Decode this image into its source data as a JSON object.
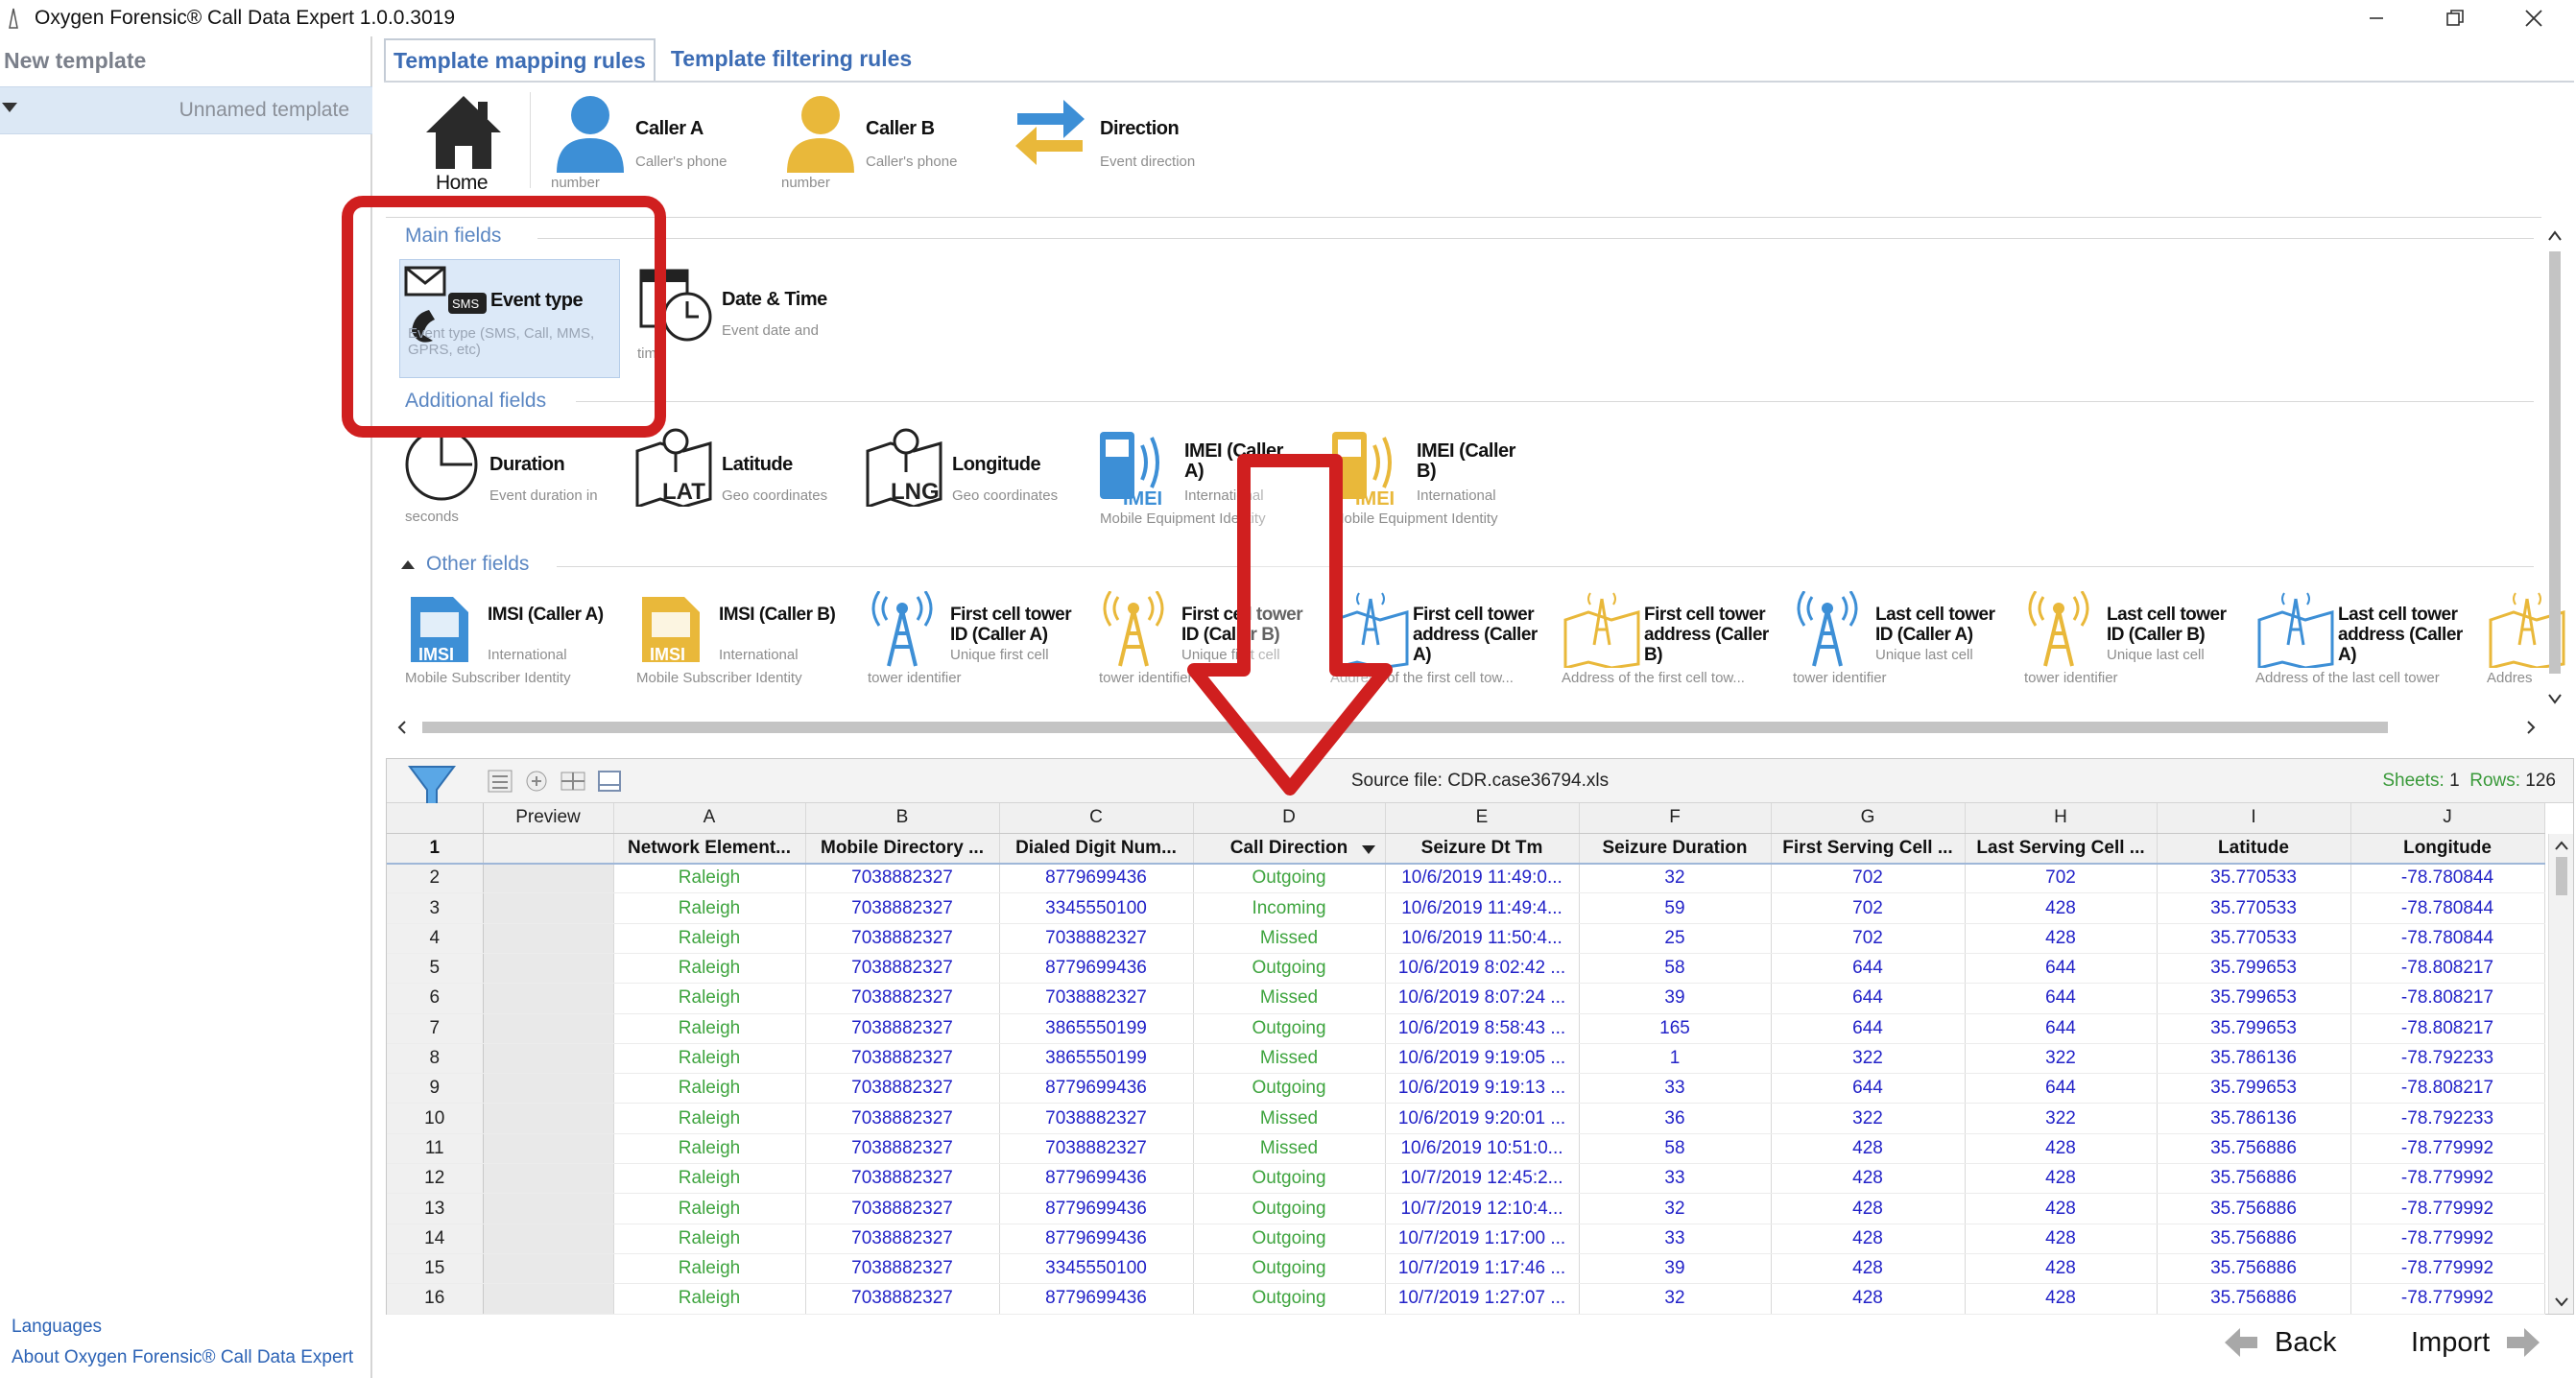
{
  "window": {
    "title": "Oxygen Forensic® Call Data Expert 1.0.0.3019"
  },
  "left_panel": {
    "title": "New template",
    "item": "Unnamed template",
    "links": [
      "Languages",
      "About Oxygen Forensic® Call Data Expert"
    ]
  },
  "tabs": [
    {
      "label": "Template mapping rules",
      "active": true
    },
    {
      "label": "Template filtering rules",
      "active": false
    }
  ],
  "top_row": {
    "home": "Home",
    "caller_a": {
      "title": "Caller A",
      "sub": "Caller's phone",
      "sub2": "number"
    },
    "caller_b": {
      "title": "Caller B",
      "sub": "Caller's phone",
      "sub2": "number"
    },
    "direction": {
      "title": "Direction",
      "sub": "Event direction"
    }
  },
  "sections": {
    "main": "Main fields",
    "additional": "Additional fields",
    "other": "Other fields"
  },
  "main_fields": {
    "event_type": {
      "title": "Event type",
      "sub": "Event type (SMS, Call, MMS, GPRS, etc)"
    },
    "date_time": {
      "title": "Date & Time",
      "sub": "Event date and",
      "sub2": "time"
    }
  },
  "additional_fields": {
    "duration": {
      "title": "Duration",
      "sub": "Event duration in",
      "sub2": "seconds"
    },
    "latitude": {
      "title": "Latitude",
      "sub": "Geo coordinates"
    },
    "longitude": {
      "title": "Longitude",
      "sub": "Geo coordinates"
    },
    "imei_a": {
      "title": "IMEI (Caller A)",
      "sub": "International",
      "sub2": "Mobile Equipment Identity"
    },
    "imei_b": {
      "title": "IMEI (Caller B)",
      "sub": "International",
      "sub2": "Mobile Equipment Identity"
    }
  },
  "other_fields": [
    {
      "title": "IMSI (Caller A)",
      "sub": "International",
      "sub2": "Mobile Subscriber Identity",
      "icon": "sim-blue"
    },
    {
      "title": "IMSI (Caller B)",
      "sub": "International",
      "sub2": "Mobile Subscriber Identity",
      "icon": "sim-gold"
    },
    {
      "title": "First cell tower ID (Caller A)",
      "sub": "Unique first cell",
      "sub2": "tower identifier",
      "icon": "tower-blue"
    },
    {
      "title": "First cell tower ID (Caller B)",
      "sub": "Unique first cell",
      "sub2": "tower identifier",
      "icon": "tower-gold"
    },
    {
      "title": "First cell tower address (Caller A)",
      "sub": "",
      "sub2": "Address of the first cell tow...",
      "icon": "map-blue"
    },
    {
      "title": "First cell tower address (Caller B)",
      "sub": "",
      "sub2": "Address of the first cell tow...",
      "icon": "map-gold"
    },
    {
      "title": "Last cell tower ID (Caller A)",
      "sub": "Unique last cell",
      "sub2": "tower identifier",
      "icon": "tower-blue"
    },
    {
      "title": "Last cell tower ID (Caller B)",
      "sub": "Unique last cell",
      "sub2": "tower identifier",
      "icon": "tower-gold"
    },
    {
      "title": "Last cell tower address (Caller A)",
      "sub": "",
      "sub2": "Address of the last cell tower",
      "icon": "map-blue"
    },
    {
      "title": "",
      "sub": "",
      "sub2": "Addres",
      "icon": "map-gold"
    }
  ],
  "grid": {
    "source": "Source file: CDR.case36794.xls",
    "sheets_label": "Sheets:",
    "sheets": "1",
    "rows_label": "Rows:",
    "rows": "126",
    "preview_label": "Preview",
    "letters": [
      "A",
      "B",
      "C",
      "D",
      "E",
      "F",
      "G",
      "H",
      "I",
      "J"
    ],
    "headers": [
      "Network Element...",
      "Mobile Directory ...",
      "Dialed Digit Num...",
      "Call Direction",
      "Seizure Dt Tm",
      "Seizure Duration",
      "First Serving Cell ...",
      "Last Serving Cell ...",
      "Latitude",
      "Longitude"
    ],
    "rows_data": [
      {
        "n": "2",
        "cells": [
          "Raleigh",
          "7038882327",
          "8779699436",
          "Outgoing",
          "10/6/2019 11:49:0...",
          "32",
          "702",
          "702",
          "35.770533",
          "-78.780844"
        ]
      },
      {
        "n": "3",
        "cells": [
          "Raleigh",
          "7038882327",
          "3345550100",
          "Incoming",
          "10/6/2019 11:49:4...",
          "59",
          "702",
          "428",
          "35.770533",
          "-78.780844"
        ]
      },
      {
        "n": "4",
        "cells": [
          "Raleigh",
          "7038882327",
          "7038882327",
          "Missed",
          "10/6/2019 11:50:4...",
          "25",
          "702",
          "428",
          "35.770533",
          "-78.780844"
        ]
      },
      {
        "n": "5",
        "cells": [
          "Raleigh",
          "7038882327",
          "8779699436",
          "Outgoing",
          "10/6/2019 8:02:42 ...",
          "58",
          "644",
          "644",
          "35.799653",
          "-78.808217"
        ]
      },
      {
        "n": "6",
        "cells": [
          "Raleigh",
          "7038882327",
          "7038882327",
          "Missed",
          "10/6/2019 8:07:24 ...",
          "39",
          "644",
          "644",
          "35.799653",
          "-78.808217"
        ]
      },
      {
        "n": "7",
        "cells": [
          "Raleigh",
          "7038882327",
          "3865550199",
          "Outgoing",
          "10/6/2019 8:58:43 ...",
          "165",
          "644",
          "644",
          "35.799653",
          "-78.808217"
        ]
      },
      {
        "n": "8",
        "cells": [
          "Raleigh",
          "7038882327",
          "3865550199",
          "Missed",
          "10/6/2019 9:19:05 ...",
          "1",
          "322",
          "322",
          "35.786136",
          "-78.792233"
        ]
      },
      {
        "n": "9",
        "cells": [
          "Raleigh",
          "7038882327",
          "8779699436",
          "Outgoing",
          "10/6/2019 9:19:13 ...",
          "33",
          "644",
          "644",
          "35.799653",
          "-78.808217"
        ]
      },
      {
        "n": "10",
        "cells": [
          "Raleigh",
          "7038882327",
          "7038882327",
          "Missed",
          "10/6/2019 9:20:01 ...",
          "36",
          "322",
          "322",
          "35.786136",
          "-78.792233"
        ]
      },
      {
        "n": "11",
        "cells": [
          "Raleigh",
          "7038882327",
          "7038882327",
          "Missed",
          "10/6/2019 10:51:0...",
          "58",
          "428",
          "428",
          "35.756886",
          "-78.779992"
        ]
      },
      {
        "n": "12",
        "cells": [
          "Raleigh",
          "7038882327",
          "8779699436",
          "Outgoing",
          "10/7/2019 12:45:2...",
          "33",
          "428",
          "428",
          "35.756886",
          "-78.779992"
        ]
      },
      {
        "n": "13",
        "cells": [
          "Raleigh",
          "7038882327",
          "8779699436",
          "Outgoing",
          "10/7/2019 12:10:4...",
          "32",
          "428",
          "428",
          "35.756886",
          "-78.779992"
        ]
      },
      {
        "n": "14",
        "cells": [
          "Raleigh",
          "7038882327",
          "8779699436",
          "Outgoing",
          "10/7/2019 1:17:00 ...",
          "33",
          "428",
          "428",
          "35.756886",
          "-78.779992"
        ]
      },
      {
        "n": "15",
        "cells": [
          "Raleigh",
          "7038882327",
          "3345550100",
          "Outgoing",
          "10/7/2019 1:17:46 ...",
          "39",
          "428",
          "428",
          "35.756886",
          "-78.779992"
        ]
      },
      {
        "n": "16",
        "cells": [
          "Raleigh",
          "7038882327",
          "8779699436",
          "Outgoing",
          "10/7/2019 1:27:07 ...",
          "32",
          "428",
          "428",
          "35.756886",
          "-78.779992"
        ]
      }
    ]
  },
  "nav": {
    "back": "Back",
    "import": "Import"
  },
  "colors": {
    "accent_blue": "#3c6cb4",
    "cell_green": "#3ea43e",
    "cell_blue": "#2222c8",
    "highlight_red": "#d01f1f"
  }
}
